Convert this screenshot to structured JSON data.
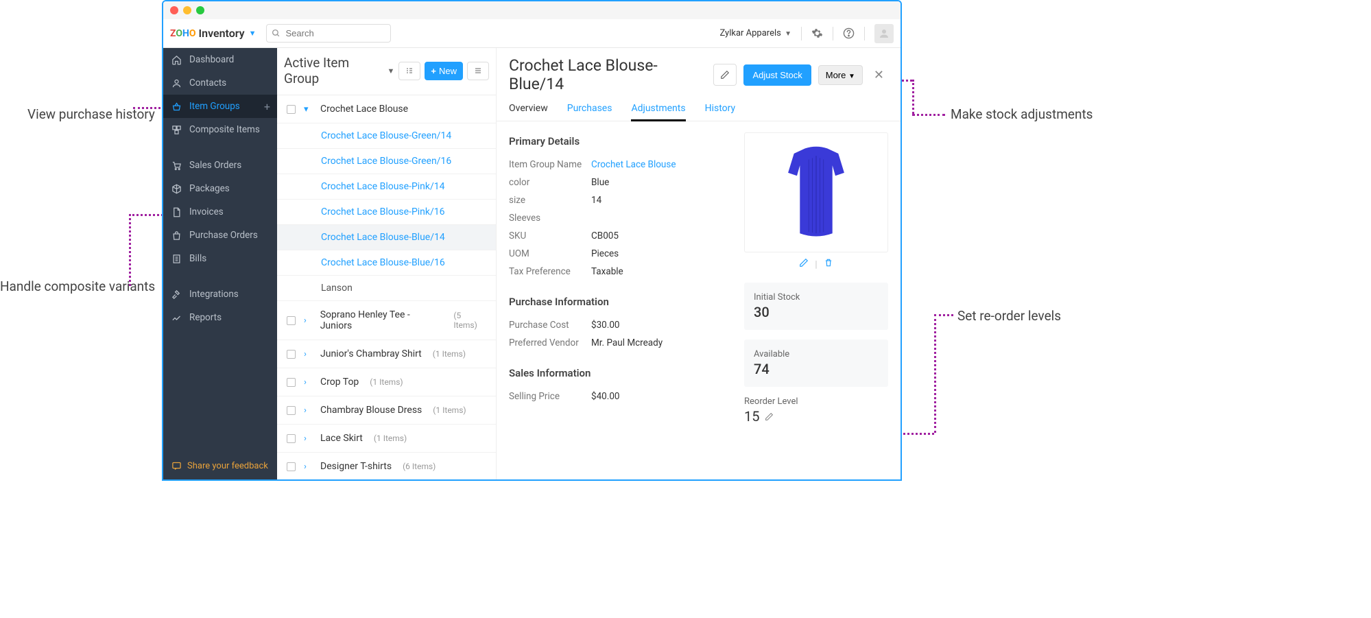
{
  "topbar": {
    "logo_brand": "ZOHO",
    "logo_app": "Inventory",
    "search_placeholder": "Search",
    "org_name": "Zylkar Apparels"
  },
  "sidebar": {
    "items": [
      {
        "icon": "home",
        "label": "Dashboard"
      },
      {
        "icon": "user",
        "label": "Contacts"
      },
      {
        "icon": "basket",
        "label": "Item Groups",
        "active": true,
        "plus": true
      },
      {
        "icon": "boxes",
        "label": "Composite Items"
      }
    ],
    "items2": [
      {
        "icon": "cart",
        "label": "Sales Orders"
      },
      {
        "icon": "package",
        "label": "Packages"
      },
      {
        "icon": "doc",
        "label": "Invoices"
      },
      {
        "icon": "bag",
        "label": "Purchase Orders"
      },
      {
        "icon": "receipt",
        "label": "Bills"
      }
    ],
    "items3": [
      {
        "icon": "plug",
        "label": "Integrations"
      },
      {
        "icon": "chart",
        "label": "Reports"
      }
    ],
    "feedback": "Share your feedback"
  },
  "mid": {
    "title": "Active Item Group",
    "new_btn": "New",
    "groups": [
      {
        "name": "Crochet Lace Blouse",
        "expanded": true,
        "variants": [
          {
            "name": "Crochet Lace Blouse-Green/14"
          },
          {
            "name": "Crochet Lace Blouse-Green/16"
          },
          {
            "name": "Crochet Lace Blouse-Pink/14"
          },
          {
            "name": "Crochet Lace Blouse-Pink/16"
          },
          {
            "name": "Crochet Lace Blouse-Blue/14",
            "selected": true
          },
          {
            "name": "Crochet Lace Blouse-Blue/16"
          },
          {
            "name": "Lanson",
            "muted": true
          }
        ]
      },
      {
        "name": "Soprano Henley Tee - Juniors",
        "meta": "(5 Items)"
      },
      {
        "name": "Junior's Chambray Shirt",
        "meta": "(1 Items)"
      },
      {
        "name": "Crop Top",
        "meta": "(1 Items)"
      },
      {
        "name": "Chambray Blouse Dress",
        "meta": "(1 Items)"
      },
      {
        "name": "Lace Skirt",
        "meta": "(1 Items)"
      },
      {
        "name": "Designer T-shirts",
        "meta": "(6 Items)"
      }
    ]
  },
  "detail": {
    "title": "Crochet Lace Blouse-Blue/14",
    "adjust_btn": "Adjust Stock",
    "more_btn": "More",
    "tabs": [
      "Overview",
      "Purchases",
      "Adjustments",
      "History"
    ],
    "primary_title": "Primary Details",
    "primary": [
      {
        "k": "Item Group Name",
        "v": "Crochet Lace Blouse",
        "link": true
      },
      {
        "k": "color",
        "v": "Blue"
      },
      {
        "k": "size",
        "v": "14"
      },
      {
        "k": "Sleeves",
        "v": ""
      },
      {
        "k": "SKU",
        "v": "CB005"
      },
      {
        "k": "UOM",
        "v": "Pieces"
      },
      {
        "k": "Tax Preference",
        "v": "Taxable"
      }
    ],
    "purchase_title": "Purchase Information",
    "purchase": [
      {
        "k": "Purchase Cost",
        "v": "$30.00"
      },
      {
        "k": "Preferred Vendor",
        "v": "Mr. Paul Mcready"
      }
    ],
    "sales_title": "Sales Information",
    "sales": [
      {
        "k": "Selling Price",
        "v": "$40.00"
      }
    ],
    "stock": {
      "initial_label": "Initial Stock",
      "initial_val": "30",
      "avail_label": "Available",
      "avail_val": "74"
    },
    "reorder": {
      "label": "Reorder Level",
      "val": "15"
    }
  },
  "annotations": {
    "a1": "View purchase history",
    "a2": "Handle composite variants",
    "a3": "Make stock adjustments",
    "a4": "Set re-order levels"
  }
}
